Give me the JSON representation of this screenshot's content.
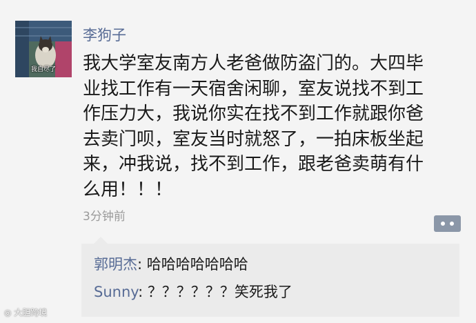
{
  "post": {
    "avatar": {
      "icon": "cat-photo-avatar",
      "caption": "我自尽了"
    },
    "username": "李狗子",
    "text_lines": [
      "我大学室友南方人老爸做防盗门的。大四毕",
      "业找工作有一天宿舍闲聊，室友说找不到工",
      "作压力大，我说你实在找不到工作就跟你爸",
      "去卖门呗，室友当时就怒了，一拍床板坐起",
      "来，冲我说，找不到工作，跟老爸卖萌有什",
      "么用！！！"
    ],
    "timestamp": "3分钟前",
    "comment_button_icon": "comment-dots-icon"
  },
  "comments": [
    {
      "author": "郭明杰",
      "separator": ": ",
      "text": "哈哈哈哈哈哈哈"
    },
    {
      "author": "Sunny",
      "separator": ": ",
      "text": "？？？？？？笑死我了"
    }
  ],
  "watermark": "大胆跨境",
  "colors": {
    "name_blue": "#576b95",
    "background": "#f4f4f4",
    "comment_bg": "#ebebeb",
    "button": "#8b97a8"
  }
}
